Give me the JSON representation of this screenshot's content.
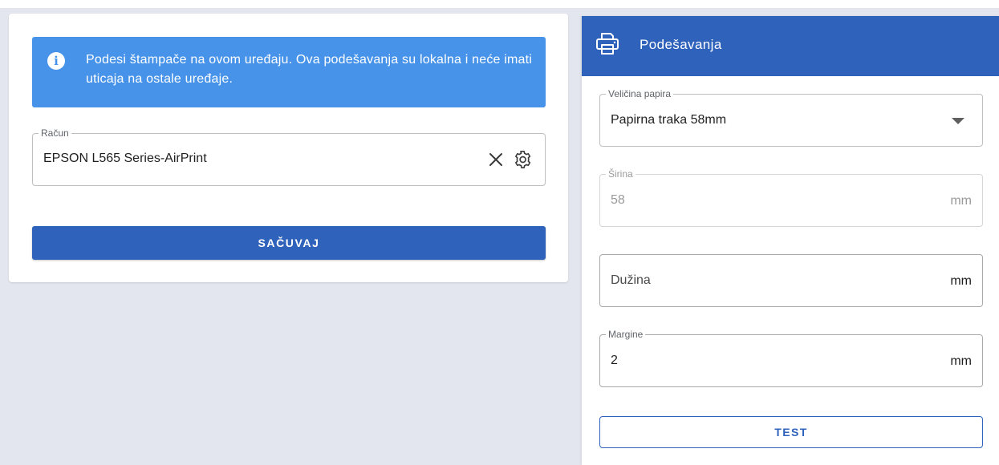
{
  "alert": {
    "icon": "info-icon",
    "text": "Podesi štampače na ovom uređaju. Ova podešavanja su lokalna i neće imati uticaja na ostale uređaje."
  },
  "receipt_printer": {
    "label": "Račun",
    "value": "EPSON L565 Series-AirPrint"
  },
  "save_button": "SAČUVAJ",
  "settings": {
    "title": "Podešavanja",
    "paper_size": {
      "label": "Veličina papira",
      "value": "Papirna traka 58mm"
    },
    "width": {
      "label": "Širina",
      "value": "58",
      "unit": "mm"
    },
    "length": {
      "placeholder": "Dužina",
      "unit": "mm"
    },
    "margins": {
      "label": "Margine",
      "value": "2",
      "unit": "mm"
    },
    "test_button": "TEST"
  },
  "colors": {
    "primary": "#2f62bb",
    "info": "#4793ea",
    "background": "#e3e6ee"
  }
}
